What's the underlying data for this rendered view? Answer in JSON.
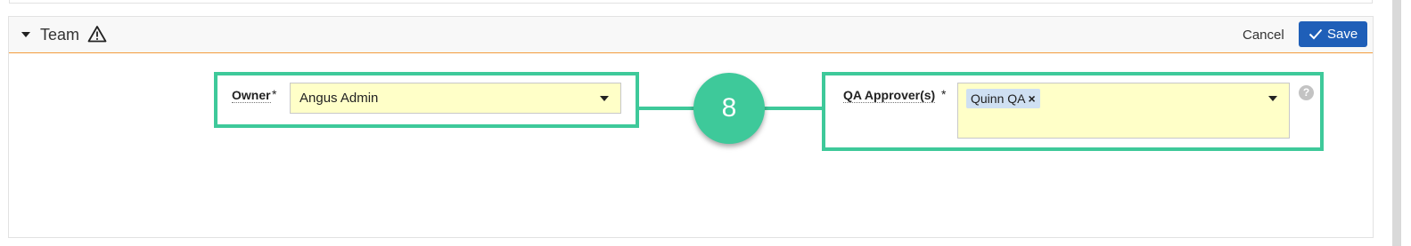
{
  "section": {
    "title": "Team",
    "cancel_label": "Cancel",
    "save_label": "Save",
    "header_border_color": "#f39c3c",
    "save_color": "#1f5fb8"
  },
  "owner": {
    "label": "Owner",
    "required_mark": "*",
    "value": "Angus Admin"
  },
  "qa": {
    "label": "QA Approver(s)",
    "required_mark": "*",
    "chips": [
      {
        "label": "Quinn QA",
        "remove": "×"
      }
    ],
    "help": "?"
  },
  "callout": {
    "number": "8",
    "color": "#3ec99a"
  },
  "field_background": "#ffffc8"
}
